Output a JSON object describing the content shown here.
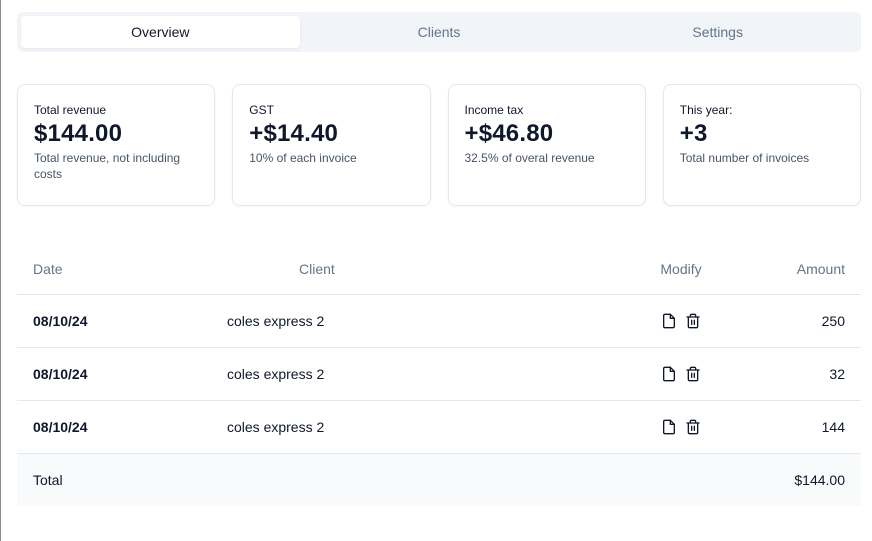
{
  "tabs": [
    {
      "label": "Overview",
      "active": true
    },
    {
      "label": "Clients",
      "active": false
    },
    {
      "label": "Settings",
      "active": false
    }
  ],
  "cards": [
    {
      "label": "Total revenue",
      "value": "$144.00",
      "description": "Total revenue, not including costs"
    },
    {
      "label": "GST",
      "value": "+$14.40",
      "description": "10% of each invoice"
    },
    {
      "label": "Income tax",
      "value": "+$46.80",
      "description": "32.5% of overal revenue"
    },
    {
      "label": "This year:",
      "value": "+3",
      "description": "Total number of invoices"
    }
  ],
  "table": {
    "headers": {
      "date": "Date",
      "client": "Client",
      "modify": "Modify",
      "amount": "Amount"
    },
    "rows": [
      {
        "date": "08/10/24",
        "client": "coles express 2",
        "amount": "250"
      },
      {
        "date": "08/10/24",
        "client": "coles express 2",
        "amount": "32"
      },
      {
        "date": "08/10/24",
        "client": "coles express 2",
        "amount": "144"
      }
    ],
    "footer": {
      "label": "Total",
      "amount": "$144.00"
    }
  },
  "icons": {
    "edit": "file-icon",
    "delete": "trash-icon"
  },
  "colors": {
    "muted_text": "#64748b",
    "border": "#e2e8f0",
    "tabs_bg": "#f1f5f9"
  }
}
